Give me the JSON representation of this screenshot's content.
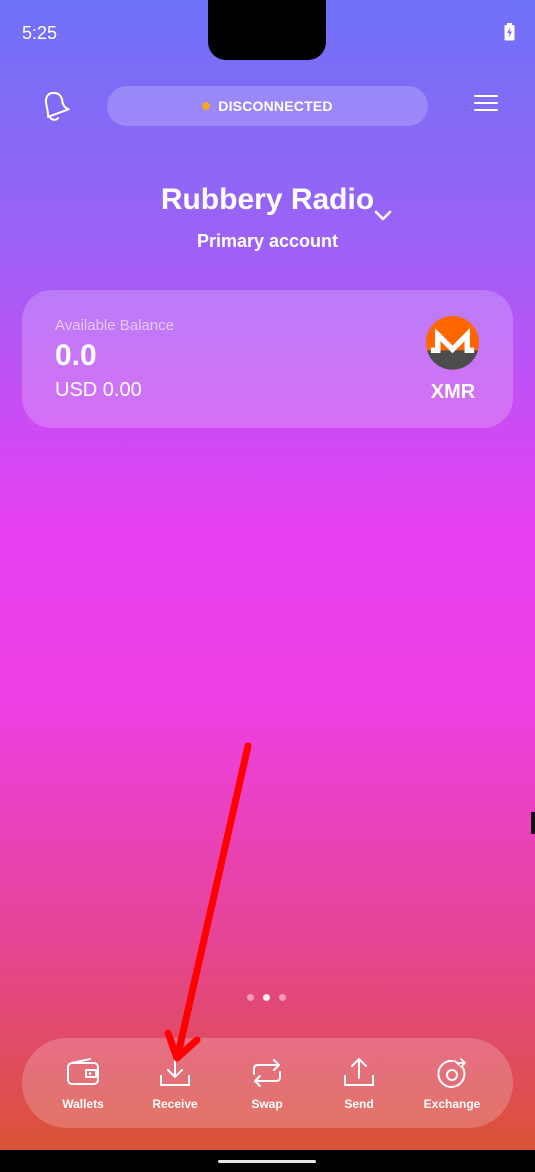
{
  "status_bar": {
    "time": "5:25"
  },
  "header": {
    "connection_status": "DISCONNECTED",
    "status_color": "#f5a623"
  },
  "wallet": {
    "name": "Rubbery Radio",
    "account": "Primary account"
  },
  "balance_card": {
    "label": "Available Balance",
    "value": "0.0",
    "fiat": "USD 0.00",
    "ticker": "XMR",
    "icon": "monero-logo"
  },
  "pager": {
    "count": 3,
    "active_index": 1
  },
  "bottom_nav": [
    {
      "label": "Wallets",
      "icon": "wallet-icon"
    },
    {
      "label": "Receive",
      "icon": "receive-icon"
    },
    {
      "label": "Swap",
      "icon": "swap-icon"
    },
    {
      "label": "Send",
      "icon": "send-icon"
    },
    {
      "label": "Exchange",
      "icon": "exchange-icon"
    }
  ],
  "annotation": {
    "arrow_color": "#ff0000",
    "points_to": "Receive"
  }
}
